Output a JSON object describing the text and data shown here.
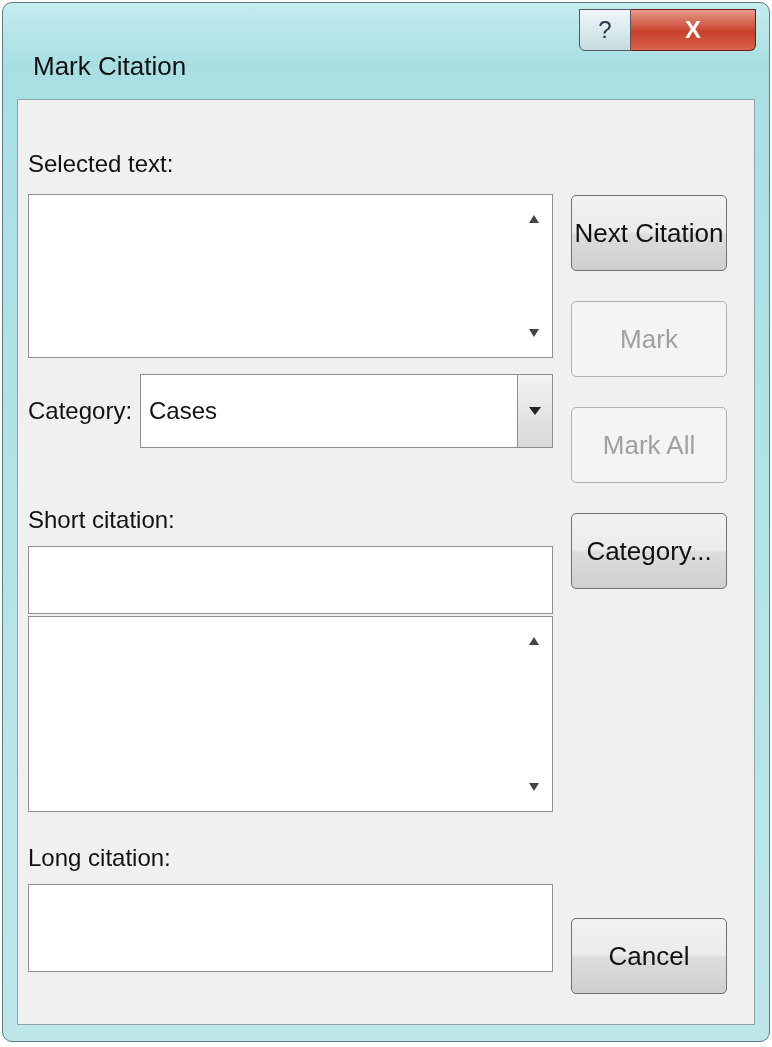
{
  "window": {
    "title": "Mark Citation",
    "help_button": "?",
    "close_button": "X"
  },
  "selected_text": {
    "label": "Selected text:"
  },
  "category": {
    "label": "Category:",
    "value": "Cases"
  },
  "short_citation": {
    "label": "Short citation:"
  },
  "long_citation": {
    "label": "Long citation:"
  },
  "buttons": [
    {
      "label": "Next Citation",
      "disabled": false
    },
    {
      "label": "Mark",
      "disabled": true
    },
    {
      "label": "Mark All",
      "disabled": true
    },
    {
      "label": "Category...",
      "disabled": false
    },
    {
      "label": "Cancel",
      "disabled": false
    }
  ]
}
